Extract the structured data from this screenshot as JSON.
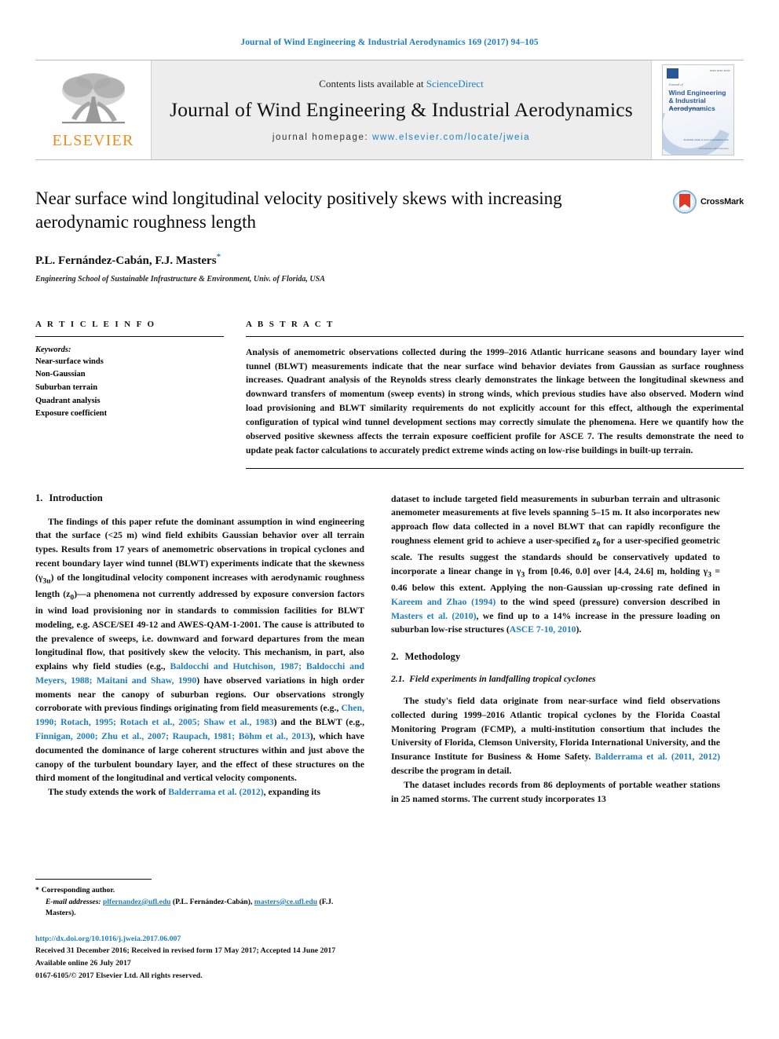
{
  "running_head": "Journal of Wind Engineering & Industrial Aerodynamics 169 (2017) 94–105",
  "masthead": {
    "contents_prefix": "Contents lists available at ",
    "sciencedirect": "ScienceDirect",
    "journal_title": "Journal of Wind Engineering & Industrial Aerodynamics",
    "homepage_label": "journal homepage: ",
    "homepage_url": "www.elsevier.com/locate/jweia",
    "publisher": "ELSEVIER",
    "cover": {
      "issn": "ISSN 0167-6105",
      "pre_title": "Journal of",
      "title": "Wind Engineering & Industrial Aerodynamics",
      "subtitle": "VOLUME 169  OCTOBER 2017",
      "editor_line": "Editors: J.D. Holmes, T. Stathopoulos, C. Letchford",
      "bottom_text": "Available online at www.sciencedirect.com",
      "bottom_text2": "www.elsevier.com/locate/jweia"
    }
  },
  "article": {
    "title": "Near surface wind longitudinal velocity positively skews with increasing aerodynamic roughness length",
    "authors": "P.L. Fernández-Cabán, F.J. Masters",
    "corresponding_marker": "*",
    "affiliation": "Engineering School of Sustainable Infrastructure & Environment, Univ. of Florida, USA",
    "crossmark_label": "CrossMark"
  },
  "article_info": {
    "heading": "A R T I C L E   I N F O",
    "keywords_label": "Keywords:",
    "keywords": [
      "Near-surface winds",
      "Non-Gaussian",
      "Suburban terrain",
      "Quadrant analysis",
      "Exposure coefficient"
    ]
  },
  "abstract": {
    "heading": "A B S T R A C T",
    "text": "Analysis of anemometric observations collected during the 1999–2016 Atlantic hurricane seasons and boundary layer wind tunnel (BLWT) measurements indicate that the near surface wind behavior deviates from Gaussian as surface roughness increases. Quadrant analysis of the Reynolds stress clearly demonstrates the linkage between the longitudinal skewness and downward transfers of momentum (sweep events) in strong winds, which previous studies have also observed. Modern wind load provisioning and BLWT similarity requirements do not explicitly account for this effect, although the experimental configuration of typical wind tunnel development sections may correctly simulate the phenomena. Here we quantify how the observed positive skewness affects the terrain exposure coefficient profile for ASCE 7. The results demonstrate the need to update peak factor calculations to accurately predict extreme winds acting on low-rise buildings in built-up terrain."
  },
  "sections": {
    "introduction_number": "1.",
    "introduction_title": "Introduction",
    "methodology_number": "2.",
    "methodology_title": "Methodology",
    "methodology_sub_number": "2.1.",
    "methodology_sub_title": "Field experiments in landfalling tropical cyclones"
  },
  "body": {
    "intro_p1_a": "The findings of this paper refute the dominant assumption in wind engineering that the surface (<25 m) wind field exhibits Gaussian behavior over all terrain types. Results from 17 years of anemometric observations in tropical cyclones and recent boundary layer wind tunnel (BLWT) experiments indicate that the skewness (γ",
    "intro_p1_sub1": "3u",
    "intro_p1_b": ") of the longitudinal velocity component increases with aerodynamic roughness length (z",
    "intro_p1_sub2": "0",
    "intro_p1_c": ")—a phenomena not currently addressed by exposure conversion factors in wind load provisioning nor in standards to commission facilities for BLWT modeling, e.g. ASCE/SEI 49-12 and AWES-QAM-1-2001. The cause is attributed to the prevalence of sweeps, i.e. downward and forward departures from the mean longitudinal flow, that positively skew the velocity. This mechanism, in part, also explains why field studies (e.g.,",
    "intro_cite_1": "Baldocchi and Hutchison, 1987; Baldocchi and Meyers, 1988; Maitani and Shaw, 1990",
    "intro_p1_d": ") have observed variations in high order moments near the canopy of suburban regions. Our observations strongly corroborate with previous findings originating from field measurements (e.g.,",
    "intro_cite_2": "Chen, 1990; Rotach, 1995; Rotach et al., 2005; Shaw et al., 1983",
    "intro_p1_e": ") and the BLWT (e.g.,",
    "intro_cite_3": "Finnigan, 2000; Zhu et al., 2007; Raupach, 1981; Böhm et al., 2013",
    "intro_p1_f": "), which have documented the dominance of large coherent structures within and just above the canopy of the turbulent boundary layer, and the effect of these structures on the third moment of the longitudinal and vertical velocity components.",
    "intro_p2_a": "The study extends the work of ",
    "intro_cite_4": "Balderrama et al. (2012)",
    "intro_p2_b": ", expanding its dataset to include targeted field measurements in suburban terrain and ultrasonic anemometer measurements at five levels spanning 5–15 m. It also incorporates new approach flow data collected in a novel BLWT that can rapidly reconfigure the roughness element grid to achieve a user-specified z",
    "intro_p2_sub1": "0",
    "intro_p2_c": " for a user-specified geometric scale. The results suggest the standards should be conservatively updated to incorporate a linear change in γ",
    "intro_p2_sub2": "3",
    "intro_p2_d": " from [0.46, 0.0] over [4.4, 24.6] m, holding γ",
    "intro_p2_sub3": "3",
    "intro_p2_e": " =  0.46 below this extent. Applying the non-Gaussian up-crossing rate defined in ",
    "intro_cite_5": "Kareem and Zhao (1994)",
    "intro_p2_f": " to the wind speed (pressure) conversion described in ",
    "intro_cite_6": "Masters et al. (2010)",
    "intro_p2_g": ", we find up to a 14% increase in the pressure loading on suburban low-rise structures (",
    "intro_cite_7": "ASCE 7-10, 2010",
    "intro_p2_h": ").",
    "meth_p1_a": "The study's field data originate from near-surface wind field observations collected during 1999–2016 Atlantic tropical cyclones by the Florida Coastal Monitoring Program (FCMP), a multi-institution consortium that includes the University of Florida, Clemson University, Florida International University, and the Insurance Institute for Business & Home Safety. ",
    "meth_cite_1": "Balderrama et al. (2011, 2012)",
    "meth_p1_b": " describe the program in detail.",
    "meth_p2": "The dataset includes records from 86 deployments of portable weather stations in 25 named storms. The current study incorporates 13"
  },
  "footnotes": {
    "corresponding_star": "*",
    "corresponding_text": "Corresponding author.",
    "email_label": "E-mail addresses:",
    "email1": "plfernandez@ufl.edu",
    "email1_owner": " (P.L. Fernández-Cabán), ",
    "email2": "masters@ce.ufl.edu",
    "email2_owner": " (F.J. Masters)."
  },
  "footer": {
    "doi": "http://dx.doi.org/10.1016/j.jweia.2017.06.007",
    "received": "Received 31 December 2016; Received in revised form 17 May 2017; Accepted 14 June 2017",
    "available": "Available online 26 July 2017",
    "copyright": "0167-6105/© 2017 Elsevier Ltd. All rights reserved."
  },
  "colors": {
    "link": "#1f7fc0",
    "elsevier_orange": "#f08c1b",
    "masthead_bg": "#ededed"
  }
}
